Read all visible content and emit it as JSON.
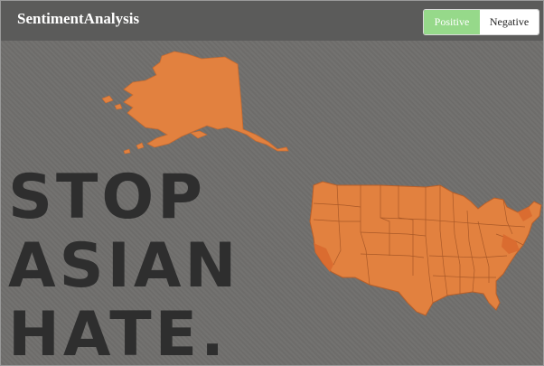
{
  "navbar": {
    "brand": "SentimentAnalysis",
    "toggle": {
      "positive_label": "Positive",
      "negative_label": "Negative",
      "selected": "Positive"
    }
  },
  "poster": {
    "lines": [
      "STOP",
      "ASIAN",
      "HATE."
    ]
  },
  "map": {
    "regions": [
      "alaska",
      "contiguous-us"
    ],
    "fill_color": "#e2813f"
  },
  "colors": {
    "navbar_bg": "#5b5b5a",
    "background": "#706f6d",
    "positive_active": "#96d98a",
    "text_dark": "#2e2e2e"
  }
}
